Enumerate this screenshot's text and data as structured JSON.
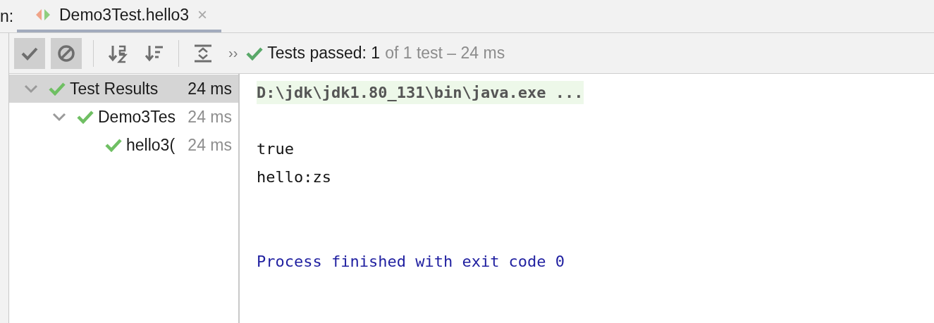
{
  "tab_bar": {
    "label": "n:",
    "tab": {
      "title": "Demo3Test.hello3",
      "selected": true,
      "close": "×"
    }
  },
  "toolbar": {
    "toggles": [
      {
        "kind": "show-passed",
        "on": true
      },
      {
        "kind": "show-ignored",
        "on": true
      }
    ],
    "tools": [
      {
        "kind": "sort-alpha"
      },
      {
        "kind": "sort-duration"
      },
      {
        "kind": "expand-collapse"
      }
    ],
    "more": "››",
    "status": {
      "passed": "Tests passed: 1",
      "rest": "of 1 test – 24 ms"
    }
  },
  "tree": [
    {
      "label": "Test Results",
      "time": "24 ms",
      "expanded": true,
      "selected": true,
      "children": [
        {
          "label": "Demo3Tes",
          "time": "24 ms",
          "expanded": true,
          "selected": false,
          "children": [
            {
              "label": "hello3(",
              "time": "24 ms",
              "selected": false
            }
          ]
        }
      ]
    }
  ],
  "console": {
    "lines": [
      {
        "kind": "command",
        "text": "D:\\jdk\\jdk1.80_131\\bin\\java.exe ..."
      },
      {
        "kind": "blank"
      },
      {
        "kind": "output",
        "text": "true"
      },
      {
        "kind": "output",
        "text": "hello:zs"
      },
      {
        "kind": "blank"
      },
      {
        "kind": "blank"
      },
      {
        "kind": "exit",
        "text": "Process finished with exit code 0"
      }
    ]
  }
}
